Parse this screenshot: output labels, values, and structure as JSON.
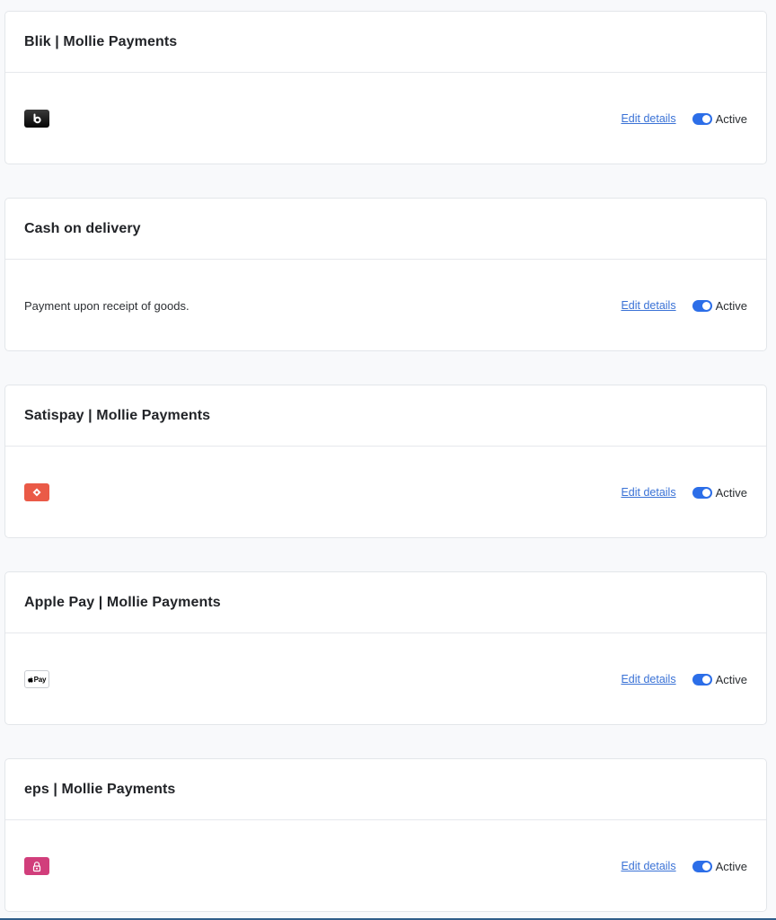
{
  "methods": [
    {
      "title": "Blik | Mollie Payments",
      "logo": "blik-logo-icon",
      "logo_text": "b",
      "description": "",
      "edit_label": "Edit details",
      "status": "Active",
      "active": true
    },
    {
      "title": "Cash on delivery",
      "logo": "",
      "logo_text": "",
      "description": "Payment upon receipt of goods.",
      "edit_label": "Edit details",
      "status": "Active",
      "active": true
    },
    {
      "title": "Satispay | Mollie Payments",
      "logo": "satispay-logo-icon",
      "logo_text": "",
      "description": "",
      "edit_label": "Edit details",
      "status": "Active",
      "active": true
    },
    {
      "title": "Apple Pay | Mollie Payments",
      "logo": "apple-pay-logo-icon",
      "logo_text": "Pay",
      "description": "",
      "edit_label": "Edit details",
      "status": "Active",
      "active": true
    },
    {
      "title": "eps | Mollie Payments",
      "logo": "eps-logo-icon",
      "logo_text": "",
      "description": "",
      "edit_label": "Edit details",
      "status": "Active",
      "active": true
    }
  ],
  "colors": {
    "link": "#3a72d6",
    "toggle_on": "#2c6ee8",
    "satispay": "#ea5a47",
    "eps": "#d13e7b",
    "blik": "#111111"
  }
}
